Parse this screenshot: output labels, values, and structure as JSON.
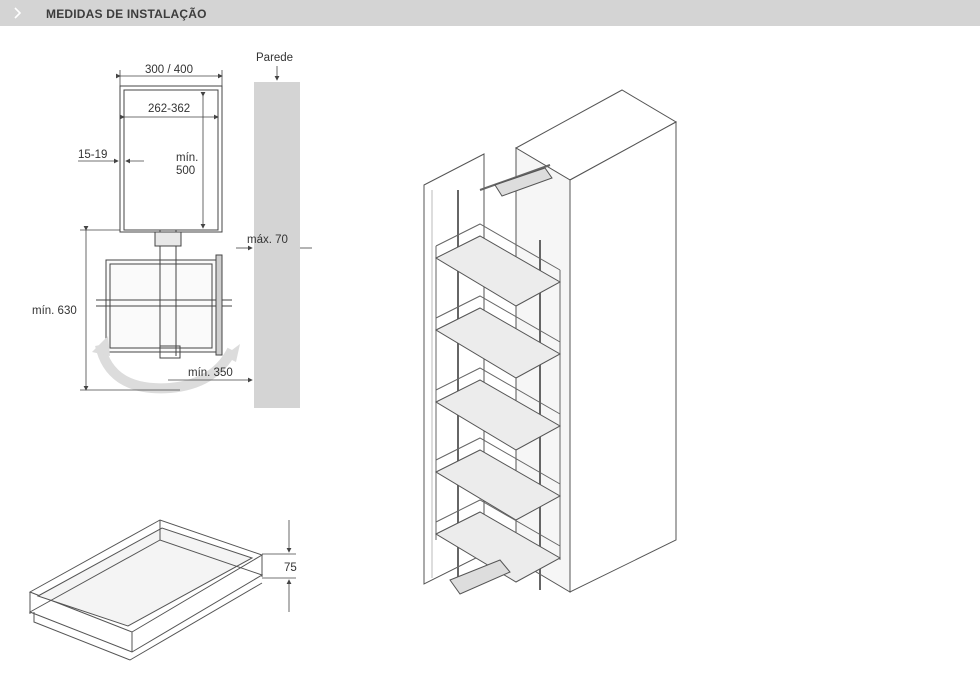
{
  "header": {
    "title": "MEDIDAS DE INSTALAÇÃO",
    "icon": "chevron-right-icon"
  },
  "plan_view": {
    "wall_label": "Parede",
    "width_outer": "300 / 400",
    "width_inner": "262-362",
    "side_gap": "15-19",
    "depth_min_line1": "mín.",
    "depth_min_line2": "500",
    "wall_gap_max": "máx. 70",
    "swing_depth_min": "mín. 630",
    "swing_clearance_min": "mín. 350"
  },
  "basket_view": {
    "height": "75"
  },
  "colors": {
    "header_bg": "#d4d4d4",
    "wall_fill": "#d4d4d4",
    "line": "#444444",
    "swing_arrow": "#dcdcdc"
  }
}
